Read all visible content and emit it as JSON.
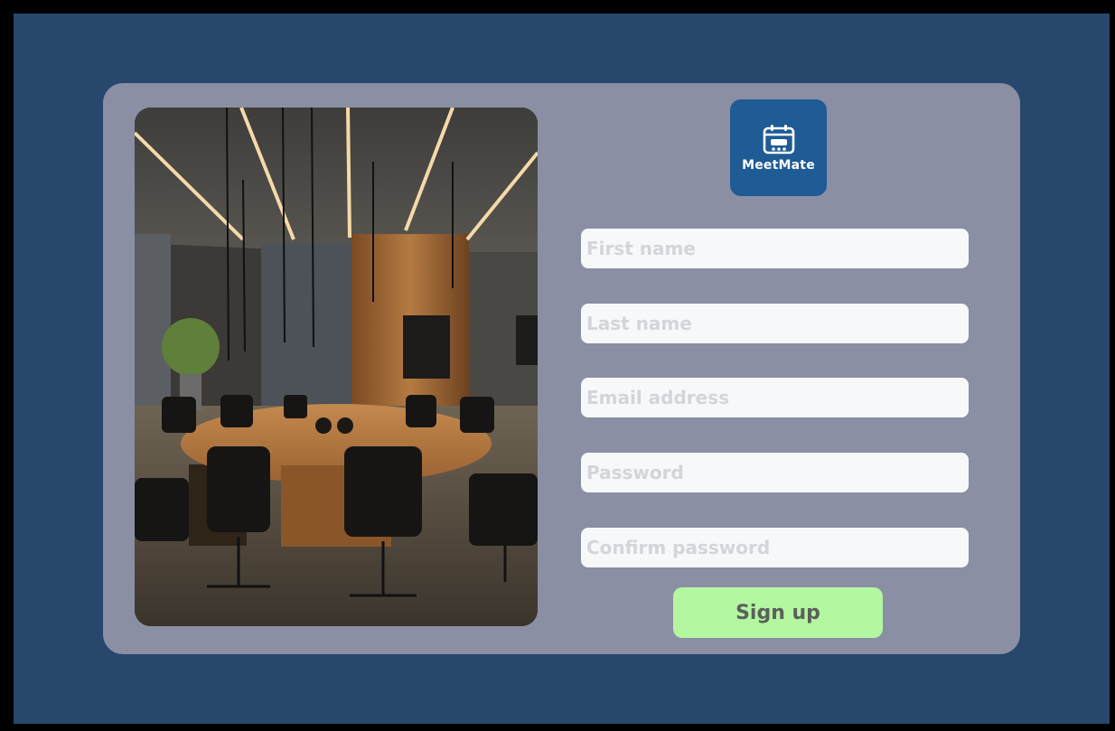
{
  "brand": {
    "name": "MeetMate",
    "logo_icon": "calendar-meeting-icon",
    "logo_bg": "#1f5b94"
  },
  "form": {
    "first_name_placeholder": "First name",
    "last_name_placeholder": "Last name",
    "email_placeholder": "Email address",
    "password_placeholder": "Password",
    "confirm_password_placeholder": "Confirm password",
    "submit_label": "Sign up"
  },
  "colors": {
    "page_bg": "#28476d",
    "card_bg": "#8a8fa3",
    "field_bg": "#f6f8fa",
    "button_bg": "#b3f7a1"
  }
}
